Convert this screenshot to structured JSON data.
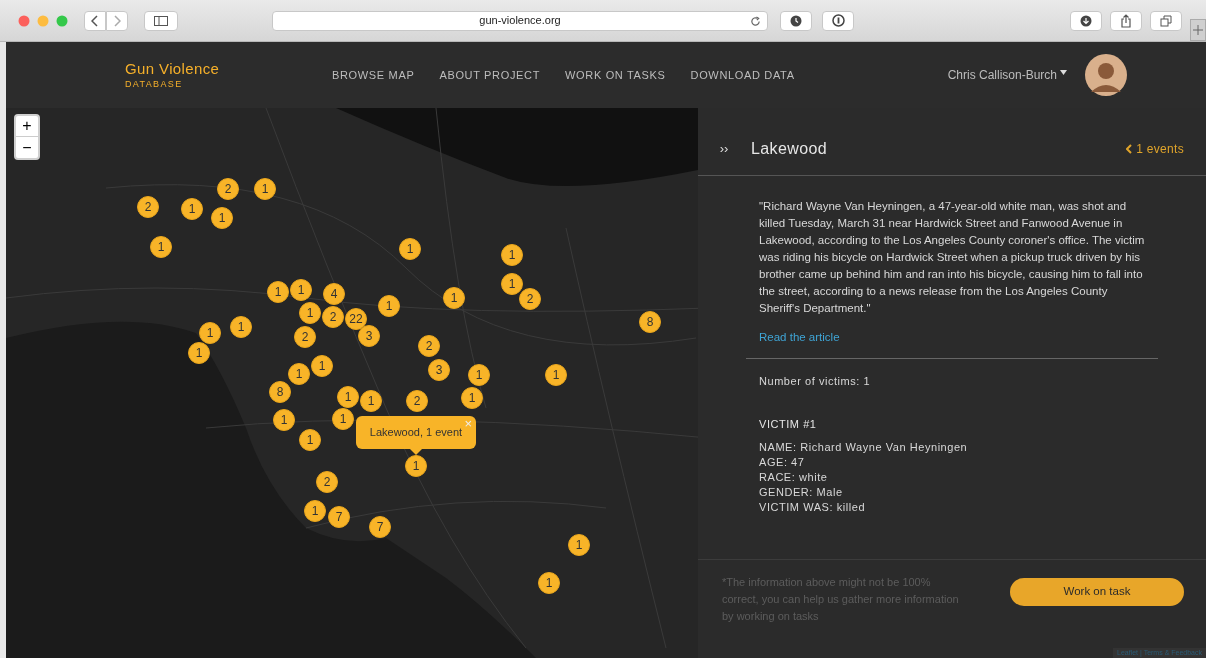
{
  "browser": {
    "url": "gun-violence.org"
  },
  "nav": {
    "logo_title": "Gun Violence",
    "logo_subtitle": "DATABASE",
    "links": [
      "BROWSE MAP",
      "ABOUT PROJECT",
      "WORK ON TASKS",
      "DOWNLOAD DATA"
    ],
    "user_name": "Chris Callison-Burch"
  },
  "map": {
    "zoom_in": "+",
    "zoom_out": "−",
    "markers": [
      {
        "count": "2"
      },
      {
        "count": "1"
      },
      {
        "count": "2"
      },
      {
        "count": "1"
      },
      {
        "count": "1"
      },
      {
        "count": "1"
      },
      {
        "count": "1"
      },
      {
        "count": "1"
      },
      {
        "count": "1"
      },
      {
        "count": "1"
      },
      {
        "count": "1"
      },
      {
        "count": "4"
      },
      {
        "count": "1"
      },
      {
        "count": "2"
      },
      {
        "count": "1"
      },
      {
        "count": "1"
      },
      {
        "count": "2"
      },
      {
        "count": "22"
      },
      {
        "count": "8"
      },
      {
        "count": "1"
      },
      {
        "count": "1"
      },
      {
        "count": "2"
      },
      {
        "count": "3"
      },
      {
        "count": "2"
      },
      {
        "count": "1"
      },
      {
        "count": "1"
      },
      {
        "count": "1"
      },
      {
        "count": "3"
      },
      {
        "count": "1"
      },
      {
        "count": "1"
      },
      {
        "count": "8"
      },
      {
        "count": "1"
      },
      {
        "count": "1"
      },
      {
        "count": "2"
      },
      {
        "count": "1"
      },
      {
        "count": "1"
      },
      {
        "count": "1"
      },
      {
        "count": "1"
      },
      {
        "count": "1"
      },
      {
        "count": "2"
      },
      {
        "count": "1"
      },
      {
        "count": "7"
      },
      {
        "count": "7"
      },
      {
        "count": "1"
      },
      {
        "count": "1"
      }
    ],
    "popup": {
      "text": "Lakewood, 1 event",
      "close": "×"
    },
    "attribution": "Leaflet | Terms & Feedback"
  },
  "panel": {
    "collapse": "››",
    "title": "Lakewood",
    "events": "1 events",
    "quote": "\"Richard Wayne Van Heyningen, a 47-year-old white man, was shot and killed Tuesday, March 31 near Hardwick Street and Fanwood Avenue in Lakewood, according to the Los Angeles County coroner's office. The victim was riding his bicycle on Hardwick Street when a pickup truck driven by his brother came up behind him and ran into his bicycle, causing him to fall into the street, according to a news release from the Los Angeles County Sheriff's Department.\"",
    "link": "Read the article",
    "victim_count": "Number of victims: 1",
    "victim_heading": "VICTIM #1",
    "victim_fields": [
      "NAME: Richard Wayne Van Heyningen",
      "AGE: 47",
      "RACE: white",
      "GENDER: Male",
      "VICTIM WAS: killed"
    ],
    "disclaimer": "*The information above might not be 100% correct, you can help us gather more information by working on tasks",
    "button": "Work on task"
  }
}
